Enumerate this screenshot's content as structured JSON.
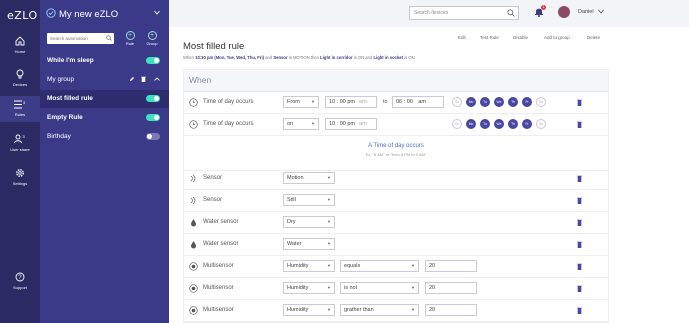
{
  "nav": {
    "logo": "eZLO",
    "items": [
      {
        "label": "Home",
        "icon": "home-icon"
      },
      {
        "label": "Devices",
        "icon": "lightbulb-icon"
      },
      {
        "label": "Rules",
        "icon": "rules-list-icon",
        "count": "3"
      },
      {
        "label": "User share",
        "icon": "user-share-icon",
        "count": "3"
      },
      {
        "label": "Settings",
        "icon": "gear-icon"
      },
      {
        "label": "Support",
        "icon": "help-icon"
      }
    ]
  },
  "sidebar": {
    "hub_title": "My new eZLO",
    "search_placeholder": "Search automation",
    "buttons": {
      "rule": "Rule",
      "group": "Group"
    },
    "items": [
      {
        "label": "While I'm sleep",
        "enabled": true
      },
      {
        "label": "My group",
        "is_group": true
      },
      {
        "label": "Most filled rule",
        "enabled": true,
        "selected": true
      },
      {
        "label": "Empty Rule",
        "enabled": true
      },
      {
        "label": "Birthday",
        "enabled": false
      }
    ]
  },
  "topbar": {
    "search_placeholder": "Search devices",
    "notification_count": "1",
    "user_name": "Daniel"
  },
  "page": {
    "title": "Most filled rule",
    "actions": [
      "Edit",
      "Test Rule",
      "Disable",
      "Add to group",
      "Delete"
    ],
    "summary": {
      "p1": "When ",
      "time": "10:30 pm (Mon, Tue, Wed, Thu, Fri)",
      "p2": " and ",
      "sensor": "Sensor",
      "p3": " is MOTION then ",
      "light1": "Light in corridor",
      "p4": " is ON and ",
      "light2": "Light in socket",
      "p5": " is ON"
    }
  },
  "when": {
    "header": "When",
    "time_rows": [
      {
        "name": "Time of day occurs",
        "mode": "From",
        "h1": "10",
        "m1": "00",
        "ap1": "pm",
        "ap1b": "am",
        "to": "to",
        "h2": "06",
        "m2": "00",
        "ap2": "am",
        "days": [
          {
            "d": "Su",
            "on": false
          },
          {
            "d": "Mo",
            "on": true
          },
          {
            "d": "Tu",
            "on": true
          },
          {
            "d": "We",
            "on": true
          },
          {
            "d": "Th",
            "on": true
          },
          {
            "d": "Fr",
            "on": true
          },
          {
            "d": "Sa",
            "on": false
          }
        ]
      },
      {
        "name": "Time of day occurs",
        "mode": "on",
        "h1": "10",
        "m1": "00",
        "ap1": "pm",
        "ap1b": "am",
        "days": [
          {
            "d": "Su",
            "on": false
          },
          {
            "d": "Mo",
            "on": true
          },
          {
            "d": "Tu",
            "on": true
          },
          {
            "d": "We",
            "on": true
          },
          {
            "d": "Th",
            "on": true
          },
          {
            "d": "Fr",
            "on": true
          },
          {
            "d": "Sa",
            "on": false
          }
        ]
      }
    ],
    "add": {
      "label": "A Time of day occurs",
      "example": "Ex. \"8 AM\" or \"from 8 PM to 9 AM\""
    },
    "device_rows": [
      {
        "name": "Sensor",
        "icon": "motion-sensor-icon",
        "value": "Motion"
      },
      {
        "name": "Sensor",
        "icon": "motion-sensor-icon",
        "value": "Still"
      },
      {
        "name": "Water sensor",
        "icon": "water-drop-icon",
        "value": "Dry"
      },
      {
        "name": "Water sensor",
        "icon": "water-drop-icon",
        "value": "Water"
      },
      {
        "name": "Multisensor",
        "icon": "multisensor-icon",
        "value": "Humidity",
        "op": "equals",
        "num": "20"
      },
      {
        "name": "Multisensor",
        "icon": "multisensor-icon",
        "value": "Humidity",
        "op": "is not",
        "num": "20"
      },
      {
        "name": "Multisensor",
        "icon": "multisensor-icon",
        "value": "Humidity",
        "op": "grather than",
        "num": "20"
      }
    ]
  },
  "colors": {
    "nav_bg": "#2b2a63",
    "sidebar_bg": "#3b3a89",
    "toggle_on": "#3ee0bf",
    "day_on": "#4848a0"
  }
}
